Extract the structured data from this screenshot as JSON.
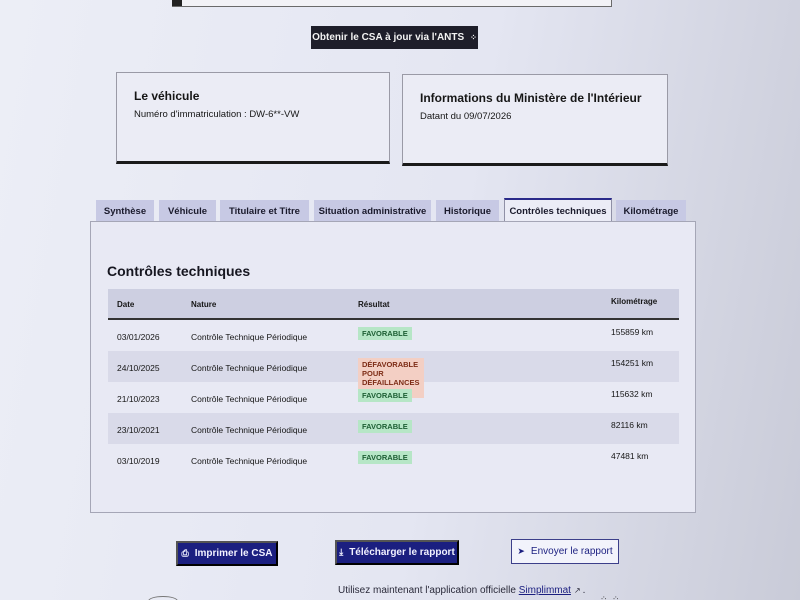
{
  "ants_button": {
    "label": "Obtenir le CSA à jour via l'ANTS",
    "icon": "sparkle-icon"
  },
  "vehicle_card": {
    "title": "Le véhicule",
    "line": "Numéro d'immatriculation : DW-6**-VW"
  },
  "ministry_card": {
    "title": "Informations du Ministère de l'Intérieur",
    "line": "Datant du 09/07/2026"
  },
  "tabs": [
    {
      "label": "Synthèse",
      "active": false
    },
    {
      "label": "Véhicule",
      "active": false
    },
    {
      "label": "Titulaire et Titre",
      "active": false
    },
    {
      "label": "Situation administrative",
      "active": false
    },
    {
      "label": "Historique",
      "active": false
    },
    {
      "label": "Contrôles techniques",
      "active": true
    },
    {
      "label": "Kilométrage",
      "active": false
    }
  ],
  "section": {
    "title": "Contrôles techniques",
    "columns": [
      "Date",
      "Nature",
      "Résultat",
      "Kilométrage"
    ],
    "rows": [
      {
        "date": "03/01/2026",
        "nature": "Contrôle Technique Périodique",
        "result": "FAVORABLE",
        "status": "ok",
        "km": "155859 km"
      },
      {
        "date": "24/10/2025",
        "nature": "Contrôle Technique Périodique",
        "result": "DÉFAVORABLE POUR DÉFAILLANCES MAJEURES",
        "status": "ko",
        "km": "154251 km"
      },
      {
        "date": "21/10/2023",
        "nature": "Contrôle Technique Périodique",
        "result": "FAVORABLE",
        "status": "ok",
        "km": "115632 km"
      },
      {
        "date": "23/10/2021",
        "nature": "Contrôle Technique Périodique",
        "result": "FAVORABLE",
        "status": "ok",
        "km": "82116 km"
      },
      {
        "date": "03/10/2019",
        "nature": "Contrôle Technique Périodique",
        "result": "FAVORABLE",
        "status": "ok",
        "km": "47481 km"
      }
    ]
  },
  "actions": {
    "print": {
      "label": "Imprimer le CSA",
      "icon": "printer-icon"
    },
    "download": {
      "label": "Télécharger le rapport",
      "icon": "download-icon"
    },
    "send": {
      "label": "Envoyer le rapport",
      "icon": "send-icon"
    }
  },
  "footer": {
    "text": "Utilisez maintenant l'application officielle",
    "link": "Simplimmat",
    "tail": "."
  },
  "colors": {
    "primary": "#1b1f80",
    "favorable_bg": "#b6e6c6",
    "defavorable_bg": "#f3cfc4"
  }
}
